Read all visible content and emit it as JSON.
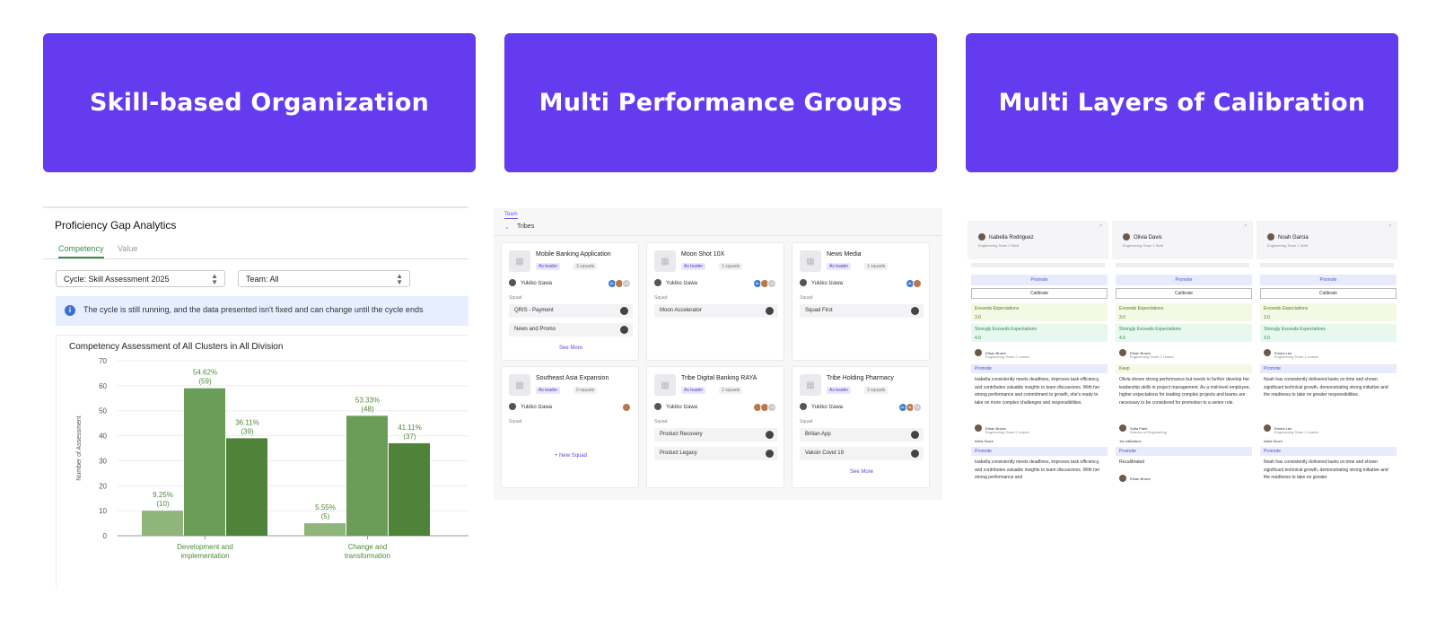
{
  "banners": [
    "Skill-based Organization",
    "Multi Performance Groups",
    "Multi Layers of Calibration"
  ],
  "gap": {
    "title": "Proficiency Gap Analytics",
    "tabs": [
      "Competency",
      "Value"
    ],
    "cycle_select": "Cycle: Skill Assessment 2025",
    "team_select": "Team: All",
    "alert": "The cycle is still running, and the data presented isn't fixed and can change until the cycle ends",
    "chart_title": "Competency Assessment of All Clusters in All Division"
  },
  "chart_data": {
    "type": "bar",
    "title": "Competency Assessment of All Clusters in All Division",
    "ylabel": "Number of Assessment",
    "ylim": [
      0,
      70
    ],
    "yticks": [
      0,
      10,
      20,
      30,
      40,
      50,
      60,
      70
    ],
    "categories": [
      [
        "Development and",
        "implementation"
      ],
      [
        "Change and",
        "transformation"
      ]
    ],
    "series": [
      {
        "color": "#8fb57d",
        "values": [
          10,
          5
        ],
        "labels": [
          [
            "9.25%",
            "(10)"
          ],
          [
            "5.55%",
            "(5)"
          ]
        ]
      },
      {
        "color": "#6a9e58",
        "values": [
          59,
          48
        ],
        "labels": [
          [
            "54.62%",
            "(59)"
          ],
          [
            "53.33%",
            "(48)"
          ]
        ]
      },
      {
        "color": "#4f8339",
        "values": [
          39,
          37
        ],
        "labels": [
          [
            "36.11%",
            "(39)"
          ],
          [
            "41.11%",
            "(37)"
          ]
        ]
      }
    ]
  },
  "teams": {
    "tab": "Team",
    "section": "Tribes",
    "leader_tag": "As leader",
    "squad_label": "Squad",
    "person": "Yukiko Izawa",
    "cards": [
      {
        "name": "Mobile Banking Application",
        "squads": "3 squads",
        "items": [
          "QRIS - Payment",
          "News and Promo"
        ],
        "more": "See More",
        "avatars": [
          "AL",
          "",
          "+6"
        ]
      },
      {
        "name": "Moon Shot 10X",
        "squads": "1 squads",
        "items": [
          "Moon Accelerator"
        ],
        "avatars": [
          "AL",
          "",
          "+2"
        ]
      },
      {
        "name": "News Media",
        "squads": "1 squads",
        "items": [
          "Squad First"
        ],
        "avatars": [
          "AL",
          ""
        ]
      },
      {
        "name": "Southeast Asia Expansion",
        "squads": "0 squads",
        "items": [],
        "new": "+ New Squad",
        "avatars": [
          ""
        ]
      },
      {
        "name": "Tribe Digital Banking RAYA",
        "squads": "2 squads",
        "items": [
          "Product Recovery",
          "Product Legacy"
        ],
        "avatars": [
          "",
          "",
          "+4"
        ]
      },
      {
        "name": "Tribe Holding Pharmacy",
        "squads": "3 squads",
        "items": [
          "Brilian App",
          "Vaksin Covid 19"
        ],
        "more": "See More",
        "avatars": [
          "AL",
          "AL",
          "+3"
        ]
      }
    ]
  },
  "calib": {
    "promote": "Promote",
    "calibrate": "Calibrate",
    "exceeds": "Exceeds Expectations",
    "strong": "Strongly Exceeds Expectations",
    "initial_score": "Initial Score",
    "first_calibration": "1st calibration",
    "cols": [
      {
        "name": "Isabella Rodriguez",
        "role": "Engineering Team 2 Staff",
        "exceeds": "3.0",
        "strong": "4.0",
        "reviewer": "Ethan Brown",
        "reviewer_role": "Engineering Team 2 Leader",
        "rec": "Promote",
        "text": "Isabella consistently meets deadlines, improves task efficiency, and contributes valuable insights to team discussions. With her strong performance and commitment to growth, she's ready to take on more complex challenges and responsibilities.",
        "reviewer2": "Ethan Brown",
        "reviewer2_role": "Engineering Team 2 Leader",
        "rec2": "Promote",
        "text2": "Isabella consistently meets deadlines, improves task efficiency, and contributes valuable insights to team discussions. With her strong performance and"
      },
      {
        "name": "Olivia Davis",
        "role": "Engineering Team 1 Staff",
        "exceeds": "3.0",
        "strong": "4.0",
        "reviewer": "Ethan Brown",
        "reviewer_role": "Engineering Team 2 Leader",
        "rec": "Keep",
        "text": "Olivia shows strong performance but needs to further develop her leadership skills in project management. As a mid-level employee, higher expectations for leading complex projects and teams are necessary to be considered for promotion to a senior role.",
        "reviewer2": "Sofia Patel",
        "reviewer2_role": "Director of Engineering",
        "rec2": "Promote",
        "text2": "Recalibrated",
        "reviewer3": "Ethan Brown"
      },
      {
        "name": "Noah Garcia",
        "role": "Engineering Team 1 Staff",
        "exceeds": "3.0",
        "strong": "3.0",
        "reviewer": "Emma Lee",
        "reviewer_role": "Engineering Team 1 Leader",
        "rec": "Promote",
        "text": "Noah has consistently delivered tasks on time and shown significant technical growth, demonstrating strong initiative and the readiness to take on greater responsibilities.",
        "reviewer2": "Emma Lee",
        "reviewer2_role": "Engineering Team 1 Leader",
        "rec2": "Promote",
        "text2": "Noah has consistently delivered tasks on time and shown significant technical growth, demonstrating strong initiative and the readiness to take on greater"
      }
    ]
  }
}
